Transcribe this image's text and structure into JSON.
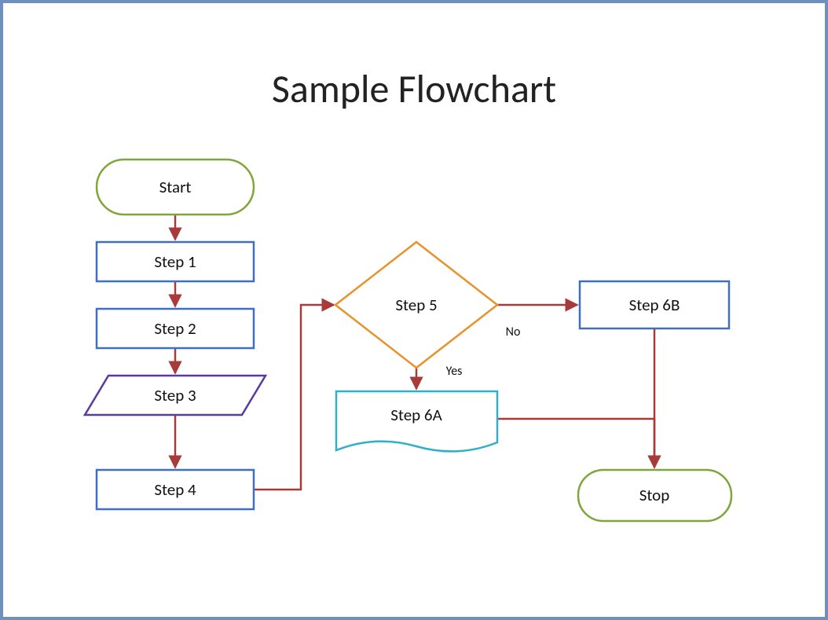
{
  "title": "Sample Flowchart",
  "nodes": {
    "start": {
      "label": "Start"
    },
    "step1": {
      "label": "Step 1"
    },
    "step2": {
      "label": "Step 2"
    },
    "step3": {
      "label": "Step 3"
    },
    "step4": {
      "label": "Step 4"
    },
    "step5": {
      "label": "Step 5"
    },
    "step6a": {
      "label": "Step 6A"
    },
    "step6b": {
      "label": "Step 6B"
    },
    "stop": {
      "label": "Stop"
    }
  },
  "edges": {
    "no": {
      "label": "No"
    },
    "yes": {
      "label": "Yes"
    }
  },
  "colors": {
    "frame": "#6f8fbd",
    "terminator": "#7fa63a",
    "process": "#3f6fbf",
    "data": "#5a3a9c",
    "decision": "#e8922c",
    "document": "#2fb0c7",
    "connector": "#a83a3a"
  }
}
